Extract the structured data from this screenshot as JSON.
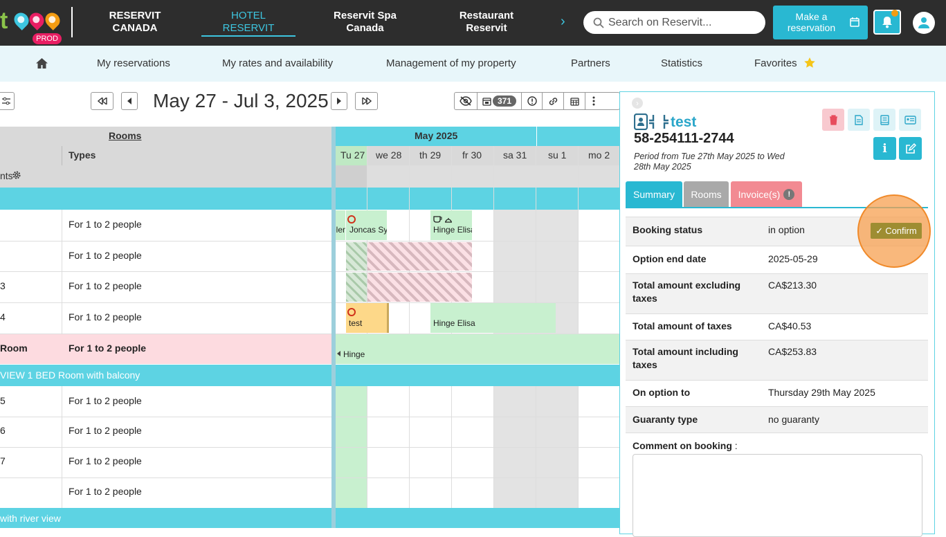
{
  "topbar": {
    "logo_letter": "t",
    "env_badge": "PROD",
    "apps": [
      {
        "line1": "RESERVIT",
        "line2": "CANADA"
      },
      {
        "line1": "HOTEL",
        "line2": "RESERVIT"
      },
      {
        "line1": "Reservit Spa",
        "line2": "Canada"
      },
      {
        "line1": "Restaurant",
        "line2": "Reservit"
      }
    ],
    "search_placeholder": "Search on Reservit...",
    "make_reservation_line1": "Make a",
    "make_reservation_line2": "reservation",
    "accent": "#29b8d2"
  },
  "subnav": {
    "items": [
      "My reservations",
      "My rates and availability",
      "Management of my property",
      "Partners",
      "Statistics",
      "Favorites"
    ]
  },
  "toolbar": {
    "date_range": "May 27 - Jul 3, 2025",
    "pending_count": "371"
  },
  "grid": {
    "rooms_header": "Rooms",
    "types_header": "Types",
    "month": "May 2025",
    "days": [
      "Tu 27",
      "we 28",
      "th 29",
      "fr 30",
      "sa 31",
      "su 1",
      "mo 2"
    ],
    "group_row_label": "nts",
    "rows": [
      {
        "room": "",
        "type": "For 1 to 2 people"
      },
      {
        "room": "",
        "type": "For 1 to 2 people"
      },
      {
        "room": "3",
        "type": "For 1 to 2 people"
      },
      {
        "room": "4",
        "type": "For 1 to 2 people"
      },
      {
        "room": "Room",
        "type": "For 1 to 2 people"
      },
      {
        "room": "5",
        "type": "For 1 to 2 people"
      },
      {
        "room": "6",
        "type": "For 1 to 2 people"
      },
      {
        "room": "7",
        "type": "For 1 to 2 people"
      },
      {
        "room": "",
        "type": "For 1 to 2 people"
      }
    ],
    "section_balcony": "VIEW 1 BED Room with balcony",
    "section_river": "with river view",
    "bookings": {
      "joncas": "Joncas Sy",
      "elen": "elen",
      "hinge1": "Hinge Elisa",
      "test": "test",
      "hinge2": "Hinge Elisa",
      "hinge3": "Hinge"
    }
  },
  "panel": {
    "guest_name": "test",
    "booking_ref": "58-254111-2744",
    "period": "Period from Tue 27th May 2025 to Wed 28th May 2025",
    "tabs": [
      "Summary",
      "Rooms",
      "Invoice(s)"
    ],
    "rows": [
      {
        "key": "Booking status",
        "value": "in option"
      },
      {
        "key": "Option end date",
        "value": "2025-05-29"
      },
      {
        "key": "Total amount excluding taxes",
        "value": "CA$213.30"
      },
      {
        "key": "Total amount of taxes",
        "value": "CA$40.53"
      },
      {
        "key": "Total amount including taxes",
        "value": "CA$253.83"
      },
      {
        "key": "On option to",
        "value": "Thursday 29th May 2025"
      },
      {
        "key": "Guaranty type",
        "value": "no guaranty"
      }
    ],
    "confirm_label": "Confirm",
    "comment_label": "Comment on booking",
    "comment_suffix": " :"
  }
}
